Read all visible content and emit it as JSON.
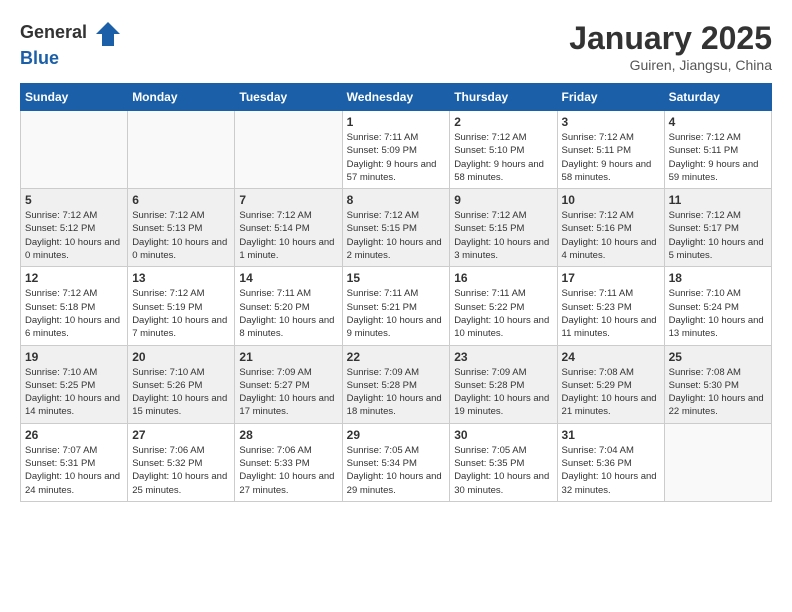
{
  "header": {
    "logo_general": "General",
    "logo_blue": "Blue",
    "month_title": "January 2025",
    "location": "Guiren, Jiangsu, China"
  },
  "days_of_week": [
    "Sunday",
    "Monday",
    "Tuesday",
    "Wednesday",
    "Thursday",
    "Friday",
    "Saturday"
  ],
  "weeks": [
    {
      "shaded": false,
      "days": [
        {
          "number": "",
          "info": ""
        },
        {
          "number": "",
          "info": ""
        },
        {
          "number": "",
          "info": ""
        },
        {
          "number": "1",
          "info": "Sunrise: 7:11 AM\nSunset: 5:09 PM\nDaylight: 9 hours and 57 minutes."
        },
        {
          "number": "2",
          "info": "Sunrise: 7:12 AM\nSunset: 5:10 PM\nDaylight: 9 hours and 58 minutes."
        },
        {
          "number": "3",
          "info": "Sunrise: 7:12 AM\nSunset: 5:11 PM\nDaylight: 9 hours and 58 minutes."
        },
        {
          "number": "4",
          "info": "Sunrise: 7:12 AM\nSunset: 5:11 PM\nDaylight: 9 hours and 59 minutes."
        }
      ]
    },
    {
      "shaded": true,
      "days": [
        {
          "number": "5",
          "info": "Sunrise: 7:12 AM\nSunset: 5:12 PM\nDaylight: 10 hours and 0 minutes."
        },
        {
          "number": "6",
          "info": "Sunrise: 7:12 AM\nSunset: 5:13 PM\nDaylight: 10 hours and 0 minutes."
        },
        {
          "number": "7",
          "info": "Sunrise: 7:12 AM\nSunset: 5:14 PM\nDaylight: 10 hours and 1 minute."
        },
        {
          "number": "8",
          "info": "Sunrise: 7:12 AM\nSunset: 5:15 PM\nDaylight: 10 hours and 2 minutes."
        },
        {
          "number": "9",
          "info": "Sunrise: 7:12 AM\nSunset: 5:15 PM\nDaylight: 10 hours and 3 minutes."
        },
        {
          "number": "10",
          "info": "Sunrise: 7:12 AM\nSunset: 5:16 PM\nDaylight: 10 hours and 4 minutes."
        },
        {
          "number": "11",
          "info": "Sunrise: 7:12 AM\nSunset: 5:17 PM\nDaylight: 10 hours and 5 minutes."
        }
      ]
    },
    {
      "shaded": false,
      "days": [
        {
          "number": "12",
          "info": "Sunrise: 7:12 AM\nSunset: 5:18 PM\nDaylight: 10 hours and 6 minutes."
        },
        {
          "number": "13",
          "info": "Sunrise: 7:12 AM\nSunset: 5:19 PM\nDaylight: 10 hours and 7 minutes."
        },
        {
          "number": "14",
          "info": "Sunrise: 7:11 AM\nSunset: 5:20 PM\nDaylight: 10 hours and 8 minutes."
        },
        {
          "number": "15",
          "info": "Sunrise: 7:11 AM\nSunset: 5:21 PM\nDaylight: 10 hours and 9 minutes."
        },
        {
          "number": "16",
          "info": "Sunrise: 7:11 AM\nSunset: 5:22 PM\nDaylight: 10 hours and 10 minutes."
        },
        {
          "number": "17",
          "info": "Sunrise: 7:11 AM\nSunset: 5:23 PM\nDaylight: 10 hours and 11 minutes."
        },
        {
          "number": "18",
          "info": "Sunrise: 7:10 AM\nSunset: 5:24 PM\nDaylight: 10 hours and 13 minutes."
        }
      ]
    },
    {
      "shaded": true,
      "days": [
        {
          "number": "19",
          "info": "Sunrise: 7:10 AM\nSunset: 5:25 PM\nDaylight: 10 hours and 14 minutes."
        },
        {
          "number": "20",
          "info": "Sunrise: 7:10 AM\nSunset: 5:26 PM\nDaylight: 10 hours and 15 minutes."
        },
        {
          "number": "21",
          "info": "Sunrise: 7:09 AM\nSunset: 5:27 PM\nDaylight: 10 hours and 17 minutes."
        },
        {
          "number": "22",
          "info": "Sunrise: 7:09 AM\nSunset: 5:28 PM\nDaylight: 10 hours and 18 minutes."
        },
        {
          "number": "23",
          "info": "Sunrise: 7:09 AM\nSunset: 5:28 PM\nDaylight: 10 hours and 19 minutes."
        },
        {
          "number": "24",
          "info": "Sunrise: 7:08 AM\nSunset: 5:29 PM\nDaylight: 10 hours and 21 minutes."
        },
        {
          "number": "25",
          "info": "Sunrise: 7:08 AM\nSunset: 5:30 PM\nDaylight: 10 hours and 22 minutes."
        }
      ]
    },
    {
      "shaded": false,
      "days": [
        {
          "number": "26",
          "info": "Sunrise: 7:07 AM\nSunset: 5:31 PM\nDaylight: 10 hours and 24 minutes."
        },
        {
          "number": "27",
          "info": "Sunrise: 7:06 AM\nSunset: 5:32 PM\nDaylight: 10 hours and 25 minutes."
        },
        {
          "number": "28",
          "info": "Sunrise: 7:06 AM\nSunset: 5:33 PM\nDaylight: 10 hours and 27 minutes."
        },
        {
          "number": "29",
          "info": "Sunrise: 7:05 AM\nSunset: 5:34 PM\nDaylight: 10 hours and 29 minutes."
        },
        {
          "number": "30",
          "info": "Sunrise: 7:05 AM\nSunset: 5:35 PM\nDaylight: 10 hours and 30 minutes."
        },
        {
          "number": "31",
          "info": "Sunrise: 7:04 AM\nSunset: 5:36 PM\nDaylight: 10 hours and 32 minutes."
        },
        {
          "number": "",
          "info": ""
        }
      ]
    }
  ]
}
